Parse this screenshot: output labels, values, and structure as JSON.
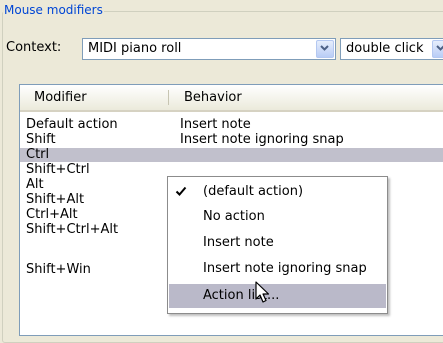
{
  "group": {
    "title": "Mouse modifiers"
  },
  "context": {
    "label": "Context:",
    "value": "MIDI piano roll",
    "action_value": "double click"
  },
  "table": {
    "columns": [
      "Modifier",
      "Behavior"
    ],
    "rows": [
      {
        "modifier": "Default action",
        "behavior": "Insert note"
      },
      {
        "modifier": "Shift",
        "behavior": "Insert note ignoring snap"
      },
      {
        "modifier": "Ctrl",
        "behavior": "",
        "selected": true
      },
      {
        "modifier": "Shift+Ctrl",
        "behavior": ""
      },
      {
        "modifier": "Alt",
        "behavior": ""
      },
      {
        "modifier": "Shift+Alt",
        "behavior": ""
      },
      {
        "modifier": "Ctrl+Alt",
        "behavior": ""
      },
      {
        "modifier": "Shift+Ctrl+Alt",
        "behavior": ""
      },
      {
        "modifier": "",
        "behavior": ""
      },
      {
        "modifier": "Shift+Win",
        "behavior": ""
      }
    ]
  },
  "menu": {
    "items": [
      {
        "label": "(default action)",
        "checked": true
      },
      {
        "label": "No action"
      },
      {
        "label": "Insert note"
      },
      {
        "label": "Insert note ignoring snap"
      },
      {
        "label": "Action list...",
        "hovered": true
      }
    ]
  },
  "colors": {
    "window_bg": "#ece9d8",
    "group_title": "#0046d5",
    "selected_row": "#c1c0cc",
    "menu_hover": "#bab9c9"
  },
  "icons": {
    "dropdown": "chevron-down-icon",
    "check": "checkmark-icon",
    "cursor": "mouse-pointer-icon"
  }
}
